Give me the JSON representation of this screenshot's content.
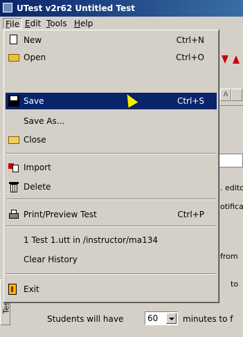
{
  "window": {
    "title": "UTest v2r62 Untitled Test"
  },
  "menubar": {
    "file": "F",
    "file_rest": "ile",
    "edit": "E",
    "edit_rest": "dit",
    "tools": "T",
    "tools_rest": "ools",
    "help": "H",
    "help_rest": "elp"
  },
  "file_menu": {
    "new": {
      "label": "New",
      "shortcut": "Ctrl+N",
      "icon": "new-document-icon"
    },
    "open": {
      "label": "Open",
      "shortcut": "Ctrl+O",
      "icon": "open-folder-icon"
    },
    "save": {
      "label": "Save",
      "shortcut": "Ctrl+S",
      "icon": "floppy-disk-icon"
    },
    "save_as": {
      "label": "Save As..."
    },
    "close": {
      "label": "Close",
      "icon": "folder-icon"
    },
    "import": {
      "label": "Import",
      "icon": "import-icon"
    },
    "delete": {
      "label": "Delete",
      "icon": "trash-icon"
    },
    "print": {
      "label": "Print/Preview Test",
      "shortcut": "Ctrl+P",
      "icon": "printer-icon"
    },
    "recent": {
      "label": "1 Test 1.utt in /instructor/ma134"
    },
    "clear_history": {
      "label": "Clear History"
    },
    "exit": {
      "label": "Exit",
      "icon": "exit-icon"
    }
  },
  "background": {
    "edit_text": ". edito",
    "notify_text": "otifica",
    "from_text": "from",
    "to_text": "to",
    "vertical_tab": "Test P",
    "students_label": "Students will have",
    "minutes_value": "60",
    "minutes_tail": "minutes to f"
  },
  "colors": {
    "highlight": "#0a246a",
    "titlebar": "#0a246a",
    "face": "#d4d0c8"
  }
}
